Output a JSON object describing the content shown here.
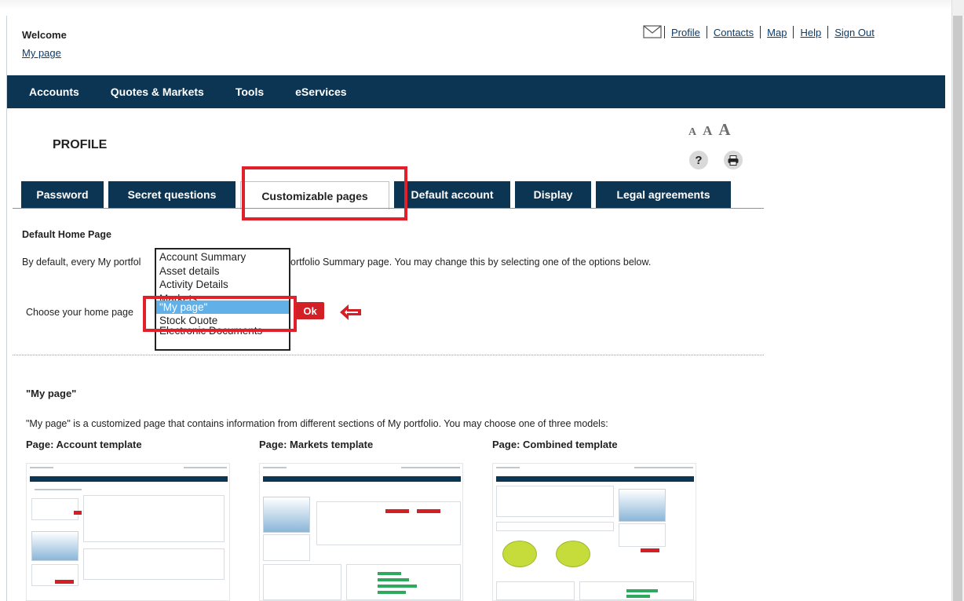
{
  "header": {
    "welcome": "Welcome",
    "my_page_link": "My page",
    "links": [
      "Profile",
      "Contacts",
      "Map",
      "Help",
      "Sign Out"
    ],
    "mail_icon": "envelope-icon"
  },
  "nav": {
    "items": [
      "Accounts",
      "Quotes & Markets",
      "Tools",
      "eServices"
    ]
  },
  "profile": {
    "title": "PROFILE",
    "font_size_labels": [
      "A",
      "A",
      "A"
    ],
    "help_icon": "?",
    "print_icon": "printer-icon"
  },
  "tabs": [
    "Password",
    "Secret questions",
    "Customizable pages",
    "Default account",
    "Display",
    "Legal agreements"
  ],
  "active_tab": "Customizable pages",
  "default_home": {
    "title": "Default Home Page",
    "description_left": "By default, every My portfol",
    "description_right": "ortfolio Summary page. You may change this by selecting one of the options below.",
    "choose_label": "Choose your home page",
    "ok_label": "Ok",
    "options": [
      "Account Summary",
      "Asset details",
      "Activity Details",
      "Markets",
      "\"My page\"",
      "Stock Quote",
      "Electronic Documents"
    ],
    "selected_option": "\"My page\"",
    "accent_color": "#d31f26",
    "highlight_color": "#e0212b",
    "selection_color": "#62b0e8"
  },
  "my_page": {
    "title": "\"My page\"",
    "description": "\"My page\" is a customized page that contains information from different sections of My portfolio. You may choose one of three models:",
    "templates": [
      {
        "title": "Page: Account template"
      },
      {
        "title": "Page: Markets template"
      },
      {
        "title": "Page: Combined template"
      }
    ]
  },
  "colors": {
    "navy": "#0c3553",
    "link": "#0a3d6b"
  }
}
